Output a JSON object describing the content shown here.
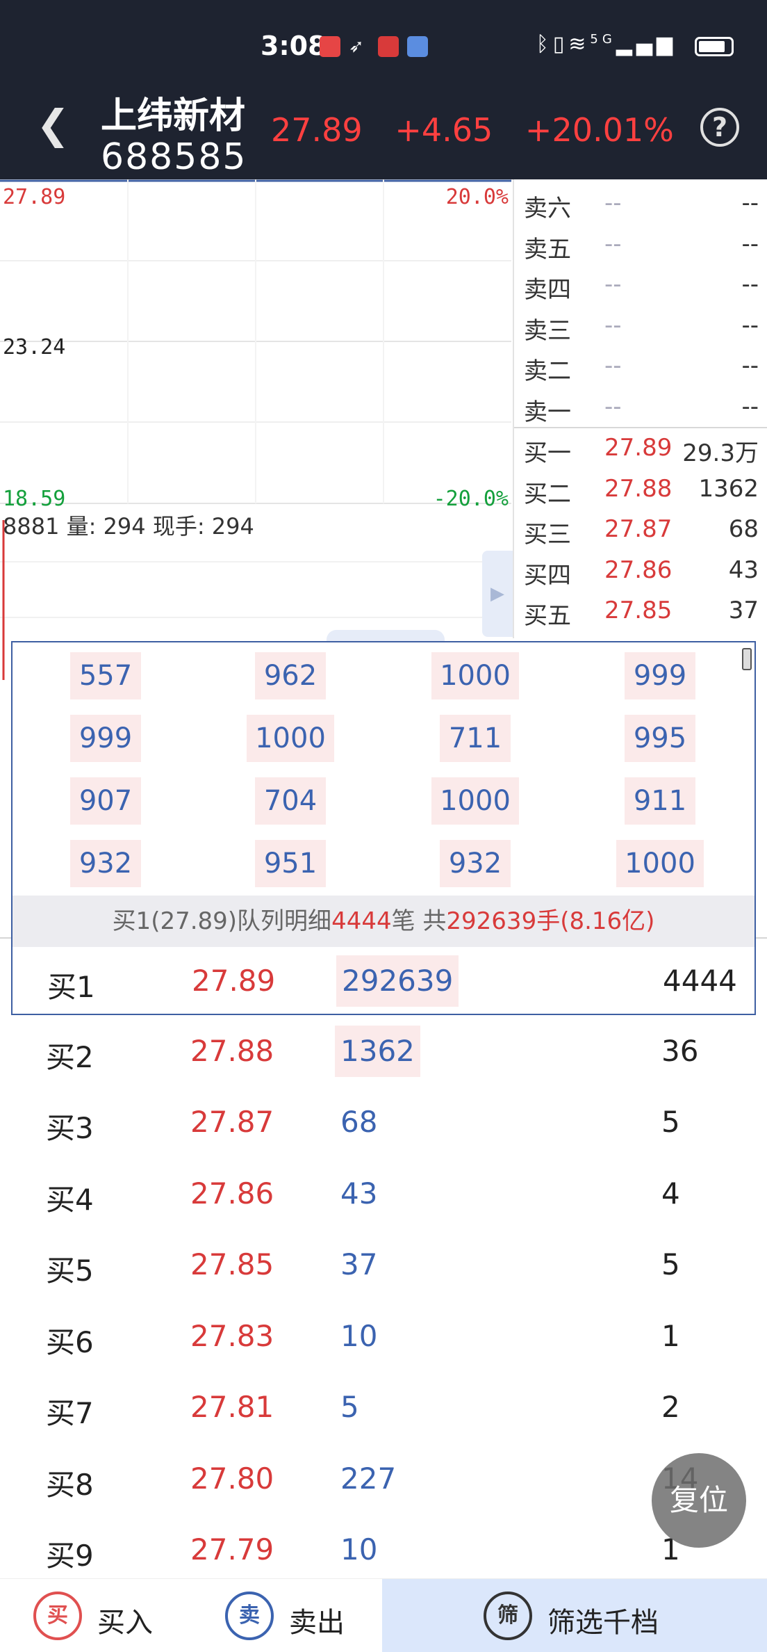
{
  "status_bar": {
    "time": "3:08",
    "network": "5G",
    "battery_level": 0.85,
    "app_icons": [
      "huawei-app-icon",
      "feather-app-icon",
      "icbc-app-icon",
      "pay-app-icon"
    ],
    "colors": {
      "app1": "#e64545",
      "app3": "#d83a3a",
      "app4": "#5b8de0"
    }
  },
  "header": {
    "stock_name": "上纬新材",
    "stock_code": "688585",
    "price": "27.89",
    "change": "+4.65",
    "change_pct": "+20.01%",
    "help": "?"
  },
  "chart": {
    "top_price": "27.89",
    "top_pct": "20.0%",
    "mid_price": "23.24",
    "bottom_price": "18.59",
    "bottom_pct": "-20.0%",
    "volume_text": "8881 量: 294 现手: 294"
  },
  "order_book": {
    "sell": [
      {
        "label": "卖六",
        "price": "--",
        "vol": "--"
      },
      {
        "label": "卖五",
        "price": "--",
        "vol": "--"
      },
      {
        "label": "卖四",
        "price": "--",
        "vol": "--"
      },
      {
        "label": "卖三",
        "price": "--",
        "vol": "--"
      },
      {
        "label": "卖二",
        "price": "--",
        "vol": "--"
      },
      {
        "label": "卖一",
        "price": "--",
        "vol": "--"
      }
    ],
    "buy": [
      {
        "label": "买一",
        "price": "27.89",
        "vol": "29.3万"
      },
      {
        "label": "买二",
        "price": "27.88",
        "vol": "1362"
      },
      {
        "label": "买三",
        "price": "27.87",
        "vol": "68"
      },
      {
        "label": "买四",
        "price": "27.86",
        "vol": "43"
      },
      {
        "label": "买五",
        "price": "27.85",
        "vol": "37"
      }
    ]
  },
  "queue": {
    "cells": [
      [
        "557",
        "962",
        "1000",
        "999"
      ],
      [
        "999",
        "1000",
        "711",
        "995"
      ],
      [
        "907",
        "704",
        "1000",
        "911"
      ],
      [
        "932",
        "951",
        "932",
        "1000"
      ]
    ],
    "summary_prefix": "买1(27.89)队列明细",
    "summary_count": "4444",
    "summary_unit": "笔  共",
    "summary_total": "292639手(8.16亿)"
  },
  "depth": [
    {
      "label": "买1",
      "price": "27.89",
      "volume": "292639",
      "count": "4444"
    },
    {
      "label": "买2",
      "price": "27.88",
      "volume": "1362",
      "count": "36"
    },
    {
      "label": "买3",
      "price": "27.87",
      "volume": "68",
      "count": "5"
    },
    {
      "label": "买4",
      "price": "27.86",
      "volume": "43",
      "count": "4"
    },
    {
      "label": "买5",
      "price": "27.85",
      "volume": "37",
      "count": "5"
    },
    {
      "label": "买6",
      "price": "27.83",
      "volume": "10",
      "count": "1"
    },
    {
      "label": "买7",
      "price": "27.81",
      "volume": "5",
      "count": "2"
    },
    {
      "label": "买8",
      "price": "27.80",
      "volume": "227",
      "count": "14"
    },
    {
      "label": "买9",
      "price": "27.79",
      "volume": "10",
      "count": "1"
    }
  ],
  "reset_label": "复位",
  "bottom_bar": {
    "buy_icon_text": "买",
    "buy_label": "买入",
    "sell_icon_text": "卖",
    "sell_label": "卖出",
    "filter_icon_text": "筛",
    "filter_label": "筛选千档"
  }
}
